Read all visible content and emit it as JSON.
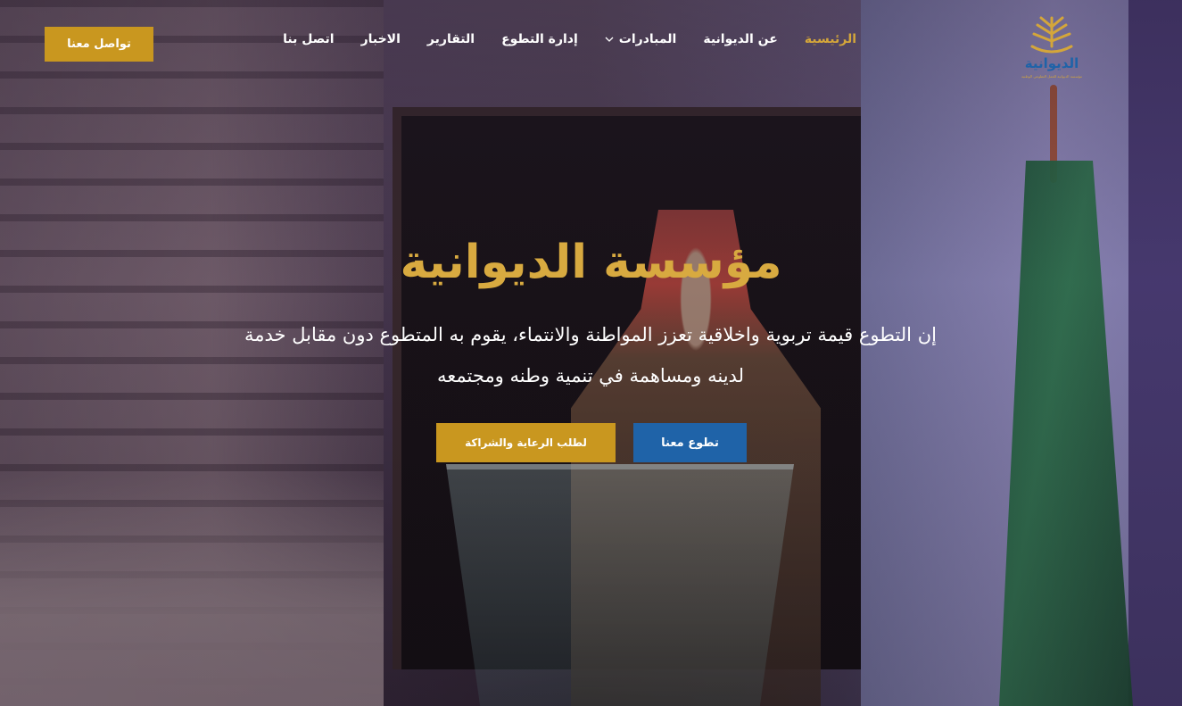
{
  "header": {
    "logo_name": "الديوانية",
    "logo_subtitle": "مؤسسة الديوانية للعمل التطوعي الوطنية",
    "nav": [
      {
        "label": "الرئيسية",
        "active": true
      },
      {
        "label": "عن الديوانية",
        "active": false
      },
      {
        "label": "المبادرات",
        "active": false,
        "has_dropdown": true
      },
      {
        "label": "إدارة التطوع",
        "active": false
      },
      {
        "label": "التقارير",
        "active": false
      },
      {
        "label": "الاخبار",
        "active": false
      },
      {
        "label": "اتصل بنا",
        "active": false
      }
    ],
    "contact_button": "تواصل معنا"
  },
  "hero": {
    "title": "مؤسسة الديوانية",
    "text": "إن التطوع قيمة تربوية واخلاقية تعزز المواطنة والانتماء، يقوم به المتطوع دون مقابل خدمة لدينه ومساهمة في تنمية وطنه ومجتمعه",
    "primary_button": "تطوع معنا",
    "secondary_button": "لطلب الرعاية والشراكة"
  },
  "colors": {
    "accent_gold": "#c9971f",
    "title_gold": "#d8aa40",
    "primary_blue": "#1f63a8",
    "nav_active": "#d4a63a"
  }
}
